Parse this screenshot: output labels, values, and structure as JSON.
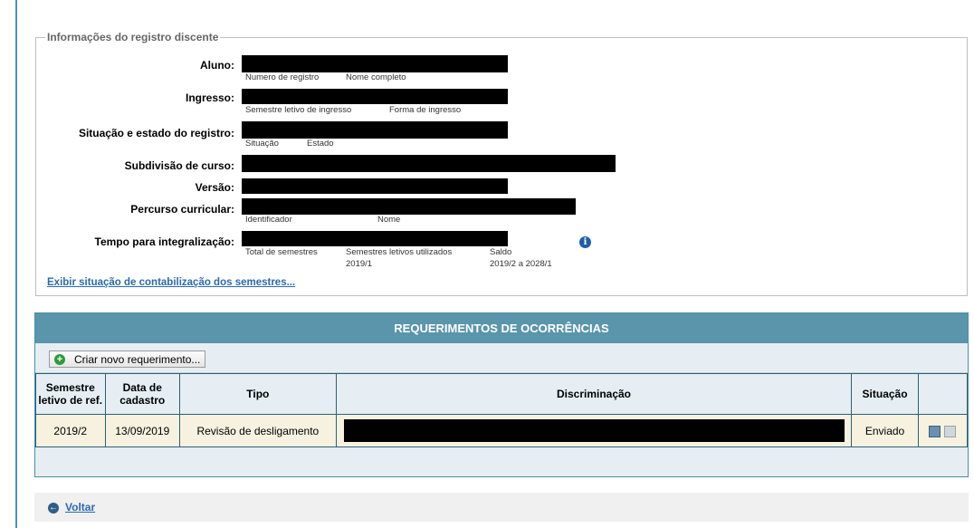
{
  "info": {
    "legend": "Informações do registro discente",
    "aluno": {
      "label": "Aluno:",
      "sub1": "Numero de registro",
      "sub2": "Nome completo"
    },
    "ingresso": {
      "label": "Ingresso:",
      "sub1": "Semestre letivo de ingresso",
      "sub2": "Forma de ingresso"
    },
    "situacao": {
      "label": "Situação e estado do registro:",
      "sub1": "Situação",
      "sub2": "Estado"
    },
    "subdivisao": {
      "label": "Subdivisão de curso:"
    },
    "versao": {
      "label": "Versão:"
    },
    "percurso": {
      "label": "Percurso curricular:",
      "sub1": "Identificador",
      "sub2": "Nome"
    },
    "tempo": {
      "label": "Tempo para integralização:",
      "sub1": "Total de semestres",
      "sub2": "Semestres letivos utilizados",
      "sub2_value": "2019/1",
      "sub3": "Saldo",
      "sub3_value": "2019/2 a 2028/1"
    },
    "link_exibir": "Exibir situação de contabilização dos semestres..."
  },
  "requerimentos": {
    "title": "REQUERIMENTOS DE OCORRÊNCIAS",
    "criar_button": "Criar novo requerimento...",
    "columns": {
      "semestre": "Semestre letivo de ref.",
      "data": "Data de cadastro",
      "tipo": "Tipo",
      "discriminacao": "Discriminação",
      "situacao": "Situação"
    },
    "rows": [
      {
        "semestre": "2019/2",
        "data": "13/09/2019",
        "tipo": "Revisão de desligamento",
        "situacao": "Enviado"
      }
    ]
  },
  "footer": {
    "voltar": "Voltar"
  },
  "icons": {
    "info": "info-icon",
    "add": "plus-icon",
    "back": "back-arrow-icon",
    "view": "view-icon",
    "print": "print-icon"
  },
  "colors": {
    "header": "#5b95ac",
    "row_bg": "#f6f2df",
    "link": "#2a6aad",
    "add_green": "#2e9b3b"
  }
}
